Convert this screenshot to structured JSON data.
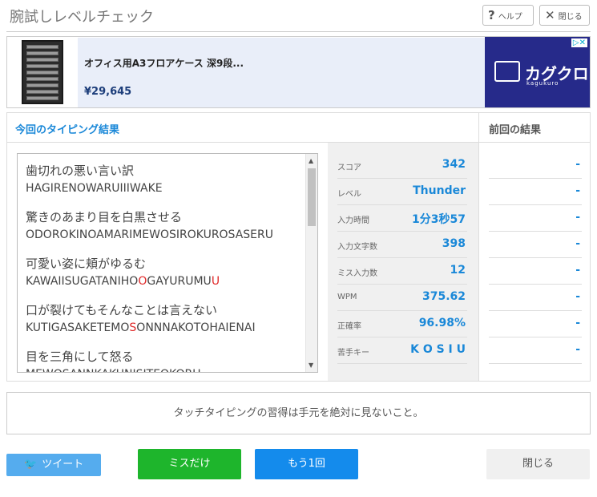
{
  "header": {
    "title": "腕試しレベルチェック",
    "help_label": "ヘルプ",
    "close_label": "閉じる"
  },
  "ad": {
    "product": "オフィス用A3フロアケース 深9段...",
    "price": "¥29,645",
    "brand": "カグクロ",
    "brand_sub": "kaguкuro"
  },
  "results": {
    "current_title": "今回のタイピング結果",
    "previous_title": "前回の結果",
    "words": [
      {
        "jp": "歯切れの悪い言い訳",
        "ro_parts": [
          {
            "t": "HAGIRENOWARUIIIWAKE",
            "miss": false
          }
        ]
      },
      {
        "jp": "驚きのあまり目を白黒させる",
        "ro_parts": [
          {
            "t": "ODOROKINOAMARIMEWOSIROKUROSASERU",
            "miss": false
          }
        ]
      },
      {
        "jp": "可愛い姿に頬がゆるむ",
        "ro_parts": [
          {
            "t": "KAWAIISUGATANIHO",
            "miss": false
          },
          {
            "t": "O",
            "miss": true
          },
          {
            "t": "GAYURUMU",
            "miss": false
          },
          {
            "t": "U",
            "miss": true
          }
        ]
      },
      {
        "jp": "口が裂けてもそんなことは言えない",
        "ro_parts": [
          {
            "t": "KUTIGASAKETEMO",
            "miss": false
          },
          {
            "t": "S",
            "miss": true
          },
          {
            "t": "ONNNAKOTOHAIENAI",
            "miss": false
          }
        ]
      },
      {
        "jp": "目を三角にして怒る",
        "ro_parts": [
          {
            "t": "MEWOSANNKAKUNISITEOKORU",
            "miss": false
          }
        ]
      }
    ],
    "stats": [
      {
        "label": "スコア",
        "value": "342",
        "prev": "-"
      },
      {
        "label": "レベル",
        "value": "Thunder",
        "prev": "-"
      },
      {
        "label": "入力時間",
        "value": "1分3秒57",
        "prev": "-"
      },
      {
        "label": "入力文字数",
        "value": "398",
        "prev": "-"
      },
      {
        "label": "ミス入力数",
        "value": "12",
        "prev": "-"
      },
      {
        "label": "WPM",
        "value": "375.62",
        "prev": "-"
      },
      {
        "label": "正確率",
        "value": "96.98%",
        "prev": "-"
      },
      {
        "label": "苦手キー",
        "value": "K O S I U",
        "prev": "-"
      }
    ]
  },
  "tip": "タッチタイピングの習得は手元を絶対に見ないこと。",
  "buttons": {
    "tweet": "ツイート",
    "miss_only": "ミスだけ",
    "again": "もう1回",
    "close": "閉じる"
  },
  "colors": {
    "accent_blue": "#1a88d8",
    "green": "#1eb52c",
    "blue_button": "#148bec",
    "twitter": "#55acee",
    "miss_red": "#e02828"
  }
}
